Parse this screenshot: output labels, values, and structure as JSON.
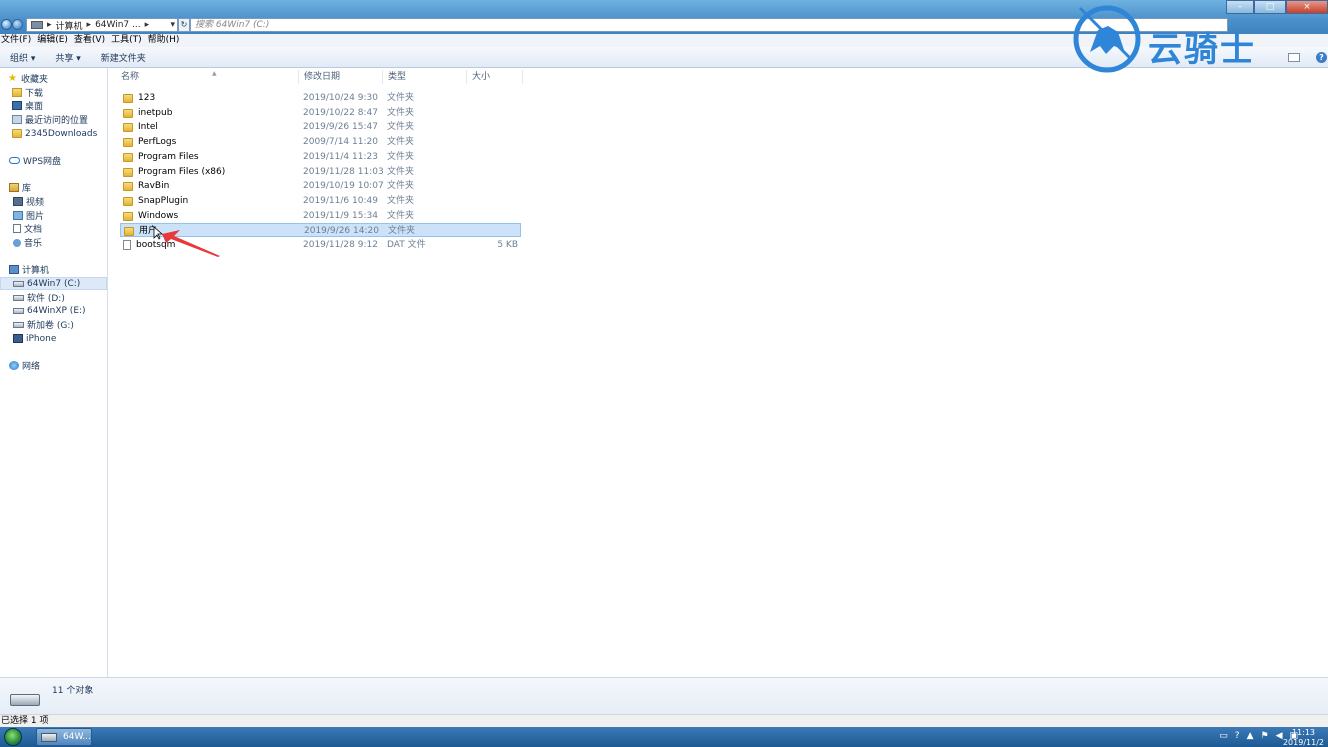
{
  "titlebar": {
    "breadcrumb": [
      "计算机",
      "64Win7 ..."
    ],
    "search_placeholder": "搜索 64Win7 (C:)",
    "window_buttons": {
      "minimize": "–",
      "maximize": "□",
      "close": "×"
    }
  },
  "menubar": [
    "文件(F)",
    "编辑(E)",
    "查看(V)",
    "工具(T)",
    "帮助(H)"
  ],
  "toolbar": {
    "organize": "组织 ▾",
    "share": "共享 ▾",
    "new_folder": "新建文件夹",
    "help": "?"
  },
  "nav": {
    "favorites": "收藏夹",
    "fav_items": [
      "下载",
      "桌面",
      "最近访问的位置",
      "2345Downloads"
    ],
    "wps": "WPS网盘",
    "library": "库",
    "lib_items": [
      "视频",
      "图片",
      "文档",
      "音乐"
    ],
    "computer": "计算机",
    "drives": [
      "64Win7 (C:)",
      "软件 (D:)",
      "64WinXP (E:)",
      "新加卷 (G:)",
      "iPhone"
    ],
    "network": "网络"
  },
  "columns": {
    "name": "名称",
    "date": "修改日期",
    "type": "类型",
    "size": "大小"
  },
  "files": [
    {
      "name": "123",
      "date": "2019/10/24 9:30",
      "type": "文件夹",
      "size": ""
    },
    {
      "name": "inetpub",
      "date": "2019/10/22 8:47",
      "type": "文件夹",
      "size": ""
    },
    {
      "name": "Intel",
      "date": "2019/9/26 15:47",
      "type": "文件夹",
      "size": ""
    },
    {
      "name": "PerfLogs",
      "date": "2009/7/14 11:20",
      "type": "文件夹",
      "size": ""
    },
    {
      "name": "Program Files",
      "date": "2019/11/4 11:23",
      "type": "文件夹",
      "size": ""
    },
    {
      "name": "Program Files (x86)",
      "date": "2019/11/28 11:03",
      "type": "文件夹",
      "size": ""
    },
    {
      "name": "RavBin",
      "date": "2019/10/19 10:07",
      "type": "文件夹",
      "size": ""
    },
    {
      "name": "SnapPlugin",
      "date": "2019/11/6 10:49",
      "type": "文件夹",
      "size": ""
    },
    {
      "name": "Windows",
      "date": "2019/11/9 15:34",
      "type": "文件夹",
      "size": ""
    },
    {
      "name": "用户",
      "date": "2019/9/26 14:20",
      "type": "文件夹",
      "size": ""
    },
    {
      "name": "bootsqm",
      "date": "2019/11/28 9:12",
      "type": "DAT 文件",
      "size": "5 KB"
    }
  ],
  "details": {
    "count": "11 个对象"
  },
  "status": {
    "text": "已选择 1 项"
  },
  "taskbar": {
    "item": "64W...",
    "time": "11:13",
    "date": "2019/11/2"
  },
  "watermark": {
    "text": "云骑士"
  },
  "colors": {
    "accent": "#2f86d8",
    "selection": "#cce2f8",
    "annotation_arrow": "#e8383a"
  }
}
